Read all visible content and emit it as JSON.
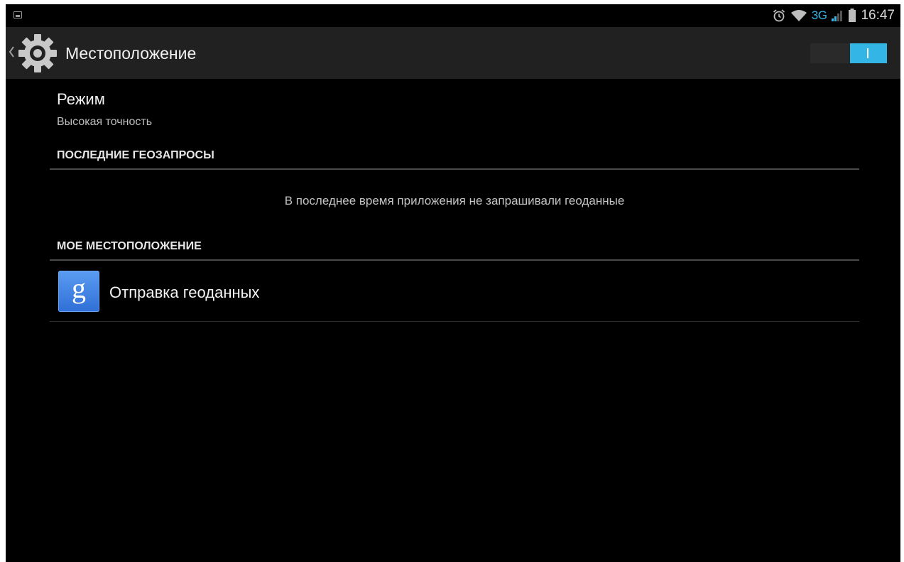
{
  "status_bar": {
    "network": "3G",
    "time": "16:47",
    "icons": [
      "notification-image-icon",
      "alarm-icon",
      "wifi-icon",
      "signal-icon",
      "battery-icon"
    ],
    "accent_color": "#33b5e5"
  },
  "action_bar": {
    "title": "Местоположение",
    "icon": "settings-gear-icon",
    "switch_on": true,
    "switch_label": "I"
  },
  "mode": {
    "title": "Режим",
    "summary": "Высокая точность"
  },
  "sections": {
    "recent_requests": {
      "header": "ПОСЛЕДНИЕ ГЕОЗАПРОСЫ",
      "empty_message": "В последнее время приложения не запрашивали геоданные"
    },
    "my_location": {
      "header": "МОЕ МЕСТОПОЛОЖЕНИЕ",
      "items": [
        {
          "title": "Отправка геоданных",
          "icon": "google-settings-icon",
          "icon_letter": "g"
        }
      ]
    }
  }
}
